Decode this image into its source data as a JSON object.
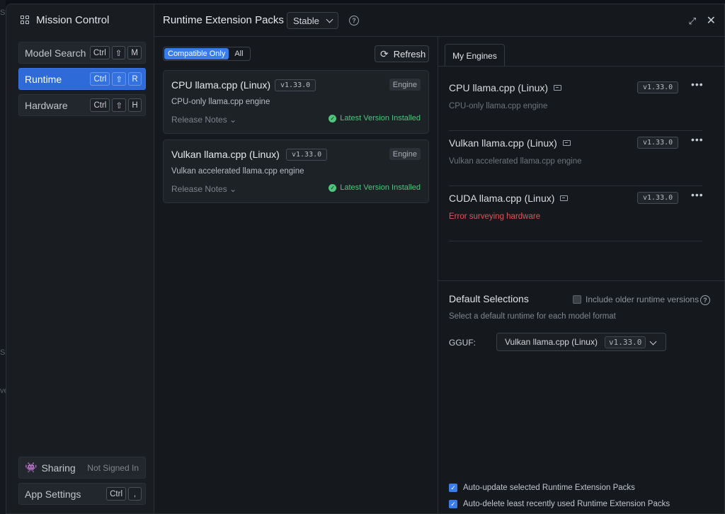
{
  "sidebar": {
    "title": "Mission Control",
    "items": [
      {
        "label": "Model Search",
        "keys": [
          "Ctrl",
          "⇧",
          "M"
        ]
      },
      {
        "label": "Runtime",
        "keys": [
          "Ctrl",
          "⇧",
          "R"
        ]
      },
      {
        "label": "Hardware",
        "keys": [
          "Ctrl",
          "⇧",
          "H"
        ]
      }
    ],
    "sharing": {
      "label": "Sharing",
      "status": "Not Signed In"
    },
    "app_settings": {
      "label": "App Settings",
      "keys": [
        "Ctrl",
        ","
      ]
    }
  },
  "header": {
    "title": "Runtime Extension Packs",
    "channel": "Stable"
  },
  "filter": {
    "compatible": "Compatible Only",
    "all": "All"
  },
  "refresh_label": "Refresh",
  "packs": [
    {
      "name": "CPU llama.cpp (Linux)",
      "version": "v1.33.0",
      "type": "Engine",
      "desc": "CPU-only llama.cpp engine",
      "release_notes": "Release Notes",
      "status": "Latest Version Installed"
    },
    {
      "name": "Vulkan llama.cpp (Linux)",
      "version": "v1.33.0",
      "type": "Engine",
      "desc": "Vulkan accelerated llama.cpp engine",
      "release_notes": "Release Notes",
      "status": "Latest Version Installed"
    }
  ],
  "my_engines": {
    "tab": "My Engines",
    "engines": [
      {
        "name": "CPU llama.cpp (Linux)",
        "version": "v1.33.0",
        "sub": "CPU-only llama.cpp engine"
      },
      {
        "name": "Vulkan llama.cpp (Linux)",
        "version": "v1.33.0",
        "sub": "Vulkan accelerated llama.cpp engine"
      },
      {
        "name": "CUDA llama.cpp (Linux)",
        "version": "v1.33.0",
        "sub": "Error surveying hardware"
      }
    ]
  },
  "defaults": {
    "title": "Default Selections",
    "older_label": "Include older runtime versions",
    "subtitle": "Select a default runtime for each model format",
    "gguf_label": "GGUF:",
    "gguf_value": "Vulkan llama.cpp (Linux)",
    "gguf_version": "v1.33.0"
  },
  "options": {
    "auto_update": "Auto-update selected Runtime Extension Packs",
    "auto_delete": "Auto-delete least recently used Runtime Extension Packs"
  },
  "background": {
    "a": "Sta",
    "b": "Su",
    "c": "vell"
  },
  "colors": {
    "accent": "#2f6ad9",
    "success": "#4fc57d",
    "error": "#e0555a"
  }
}
